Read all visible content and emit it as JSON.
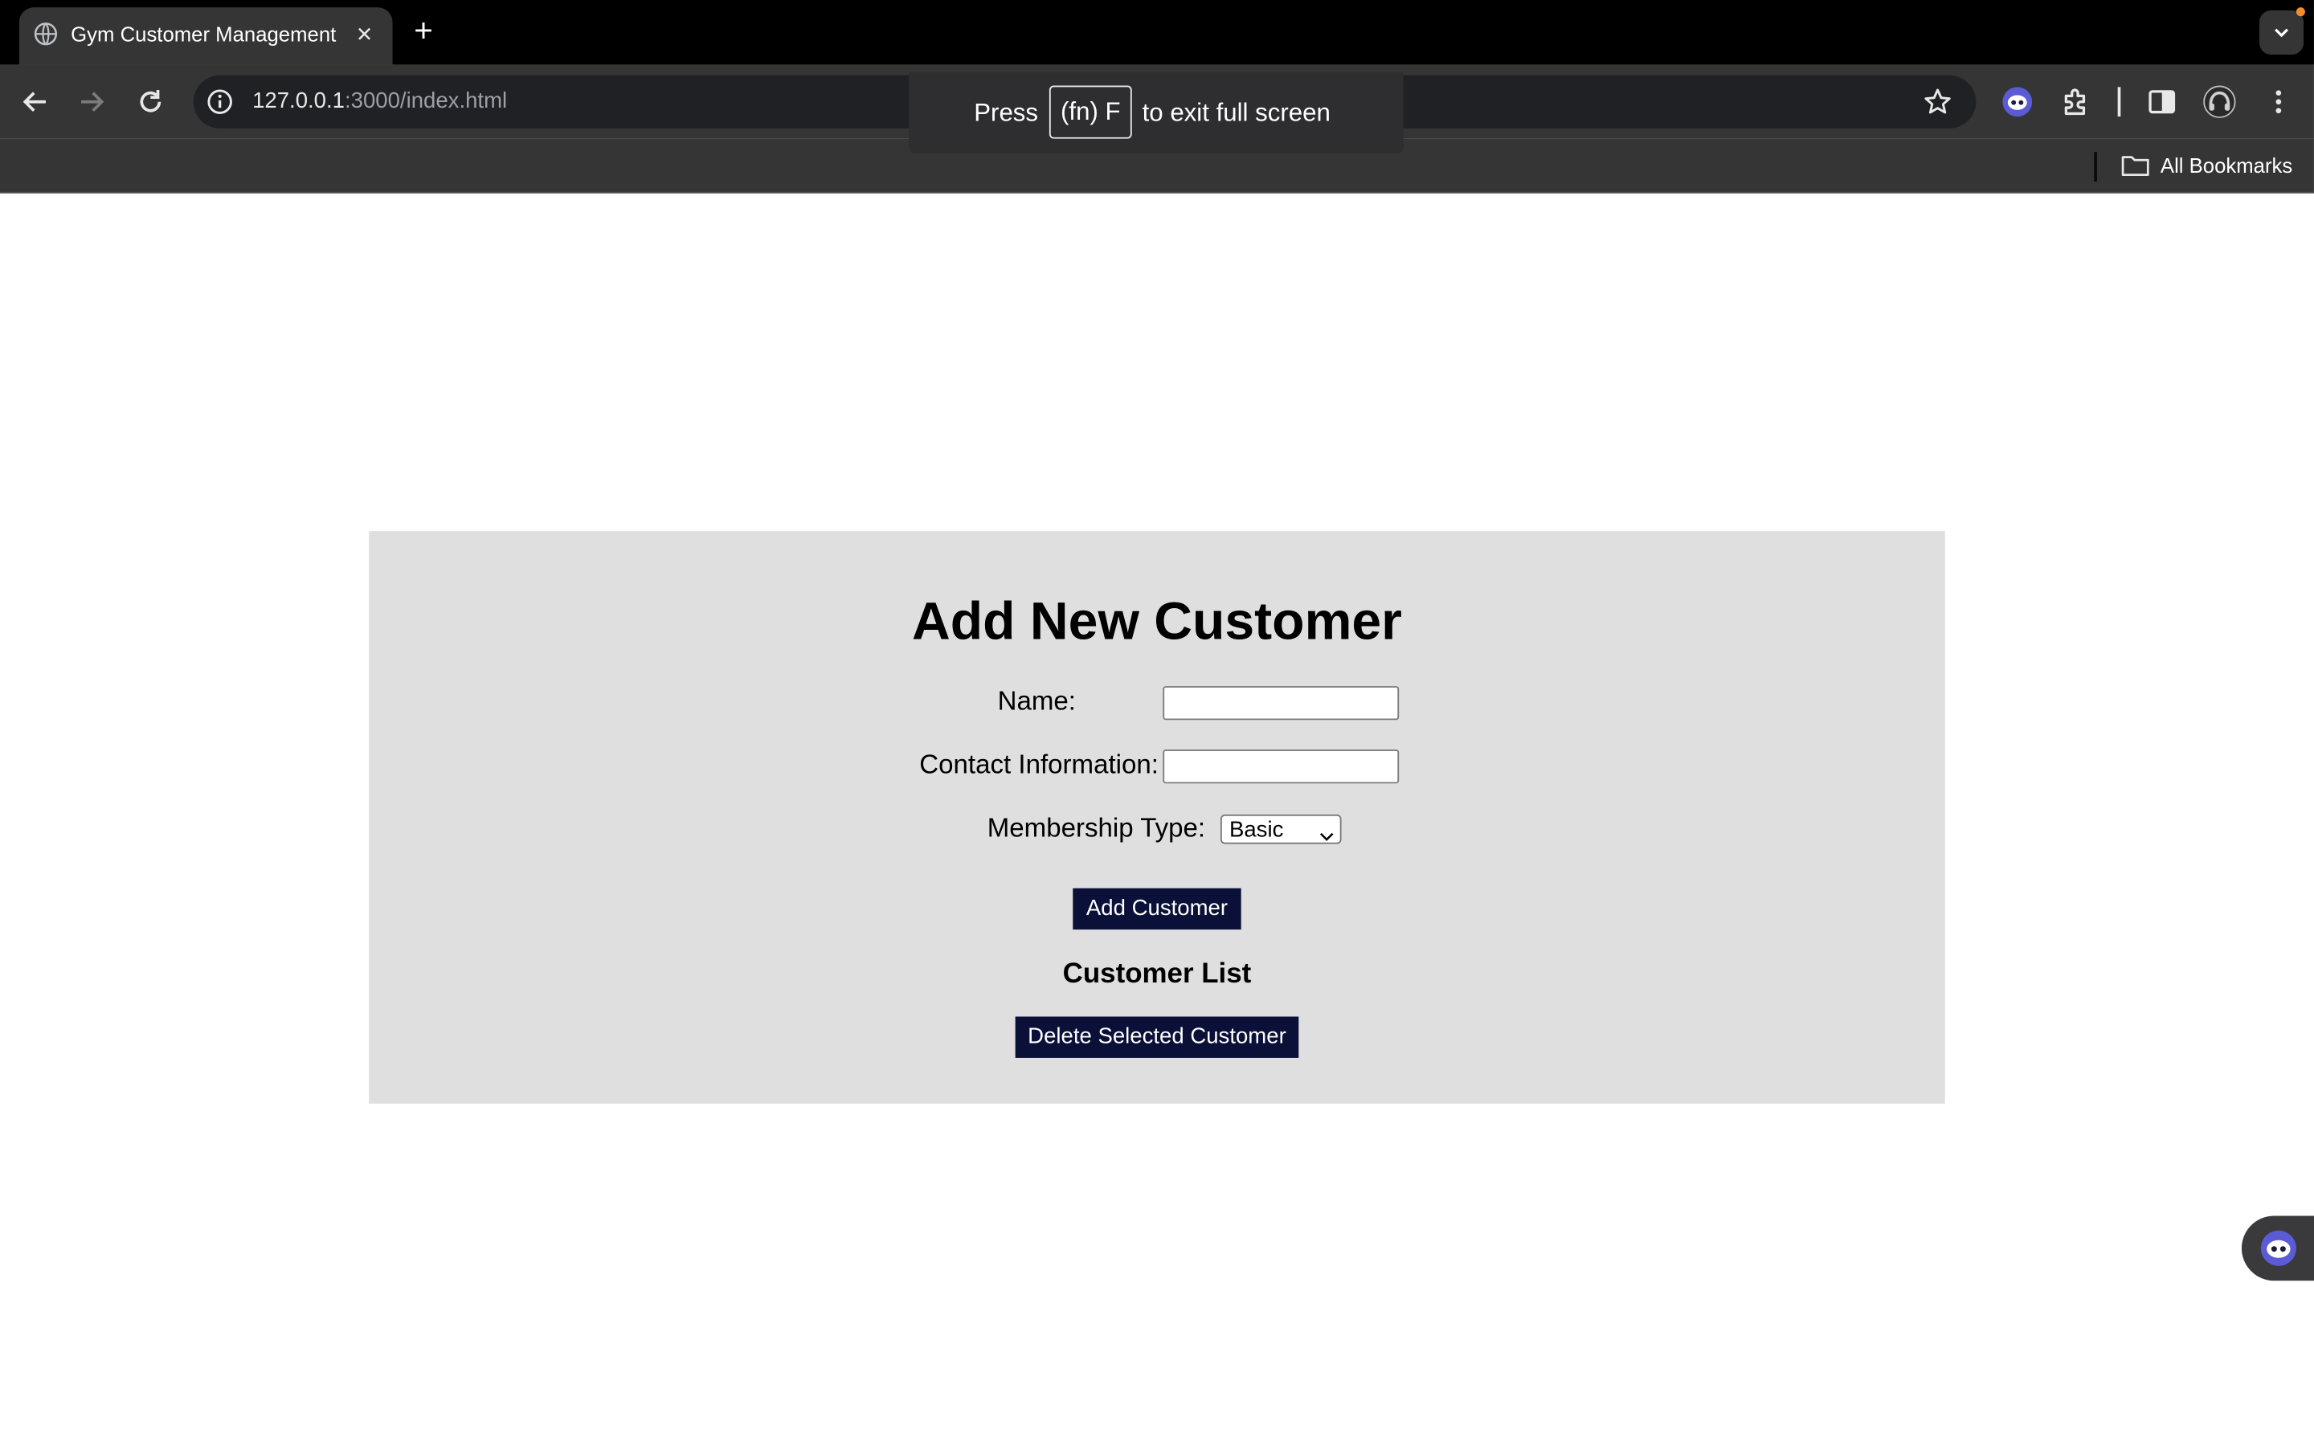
{
  "browser": {
    "tab_title": "Gym Customer Management",
    "tab_close": "✕",
    "new_tab": "+",
    "url_host": "127.0.0.1",
    "url_rest": ":3000/index.html",
    "bookmarks_label": "All Bookmarks",
    "icons": [
      "globe-icon",
      "close-icon",
      "plus-icon",
      "chevron-down-icon",
      "back-arrow-icon",
      "forward-arrow-icon",
      "reload-icon",
      "info-icon",
      "star-icon",
      "assistant-icon",
      "extensions-icon",
      "side-panel-icon",
      "profile-icon",
      "more-vert-icon",
      "folder-icon"
    ]
  },
  "fullscreen_hint": {
    "press": "Press",
    "key": "(fn) F",
    "rest": "to exit full screen"
  },
  "form": {
    "title": "Add New Customer",
    "name_label": "Name:",
    "name_value": "",
    "contact_label": "Contact Information:",
    "contact_value": "",
    "membership_label": "Membership Type:",
    "membership_selected": "Basic",
    "add_button": "Add Customer"
  },
  "customer_list": {
    "title": "Customer List",
    "delete_button": "Delete Selected Customer",
    "items": []
  },
  "colors": {
    "panel_bg": "#e0dfe0",
    "button_bg": "#0b1038",
    "chrome_dark": "#353535",
    "tabstrip": "#000000",
    "accent_indicator": "#f28b2c"
  }
}
